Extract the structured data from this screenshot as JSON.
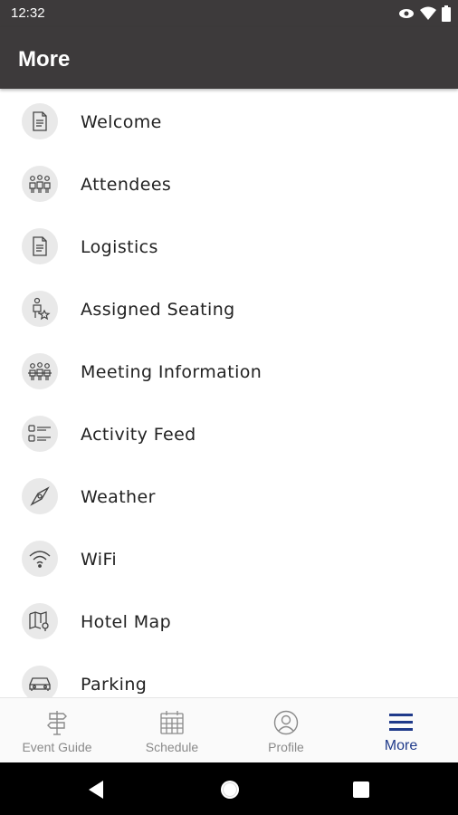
{
  "status_bar": {
    "time": "12:32",
    "icons": [
      "eye-icon",
      "wifi-icon",
      "battery-icon"
    ]
  },
  "app_bar": {
    "title": "More"
  },
  "menu": {
    "items": [
      {
        "label": "Welcome",
        "icon": "document-icon"
      },
      {
        "label": "Attendees",
        "icon": "people-group-icon"
      },
      {
        "label": "Logistics",
        "icon": "document-icon"
      },
      {
        "label": "Assigned Seating",
        "icon": "seating-icon"
      },
      {
        "label": "Meeting Information",
        "icon": "people-group-icon"
      },
      {
        "label": "Activity Feed",
        "icon": "list-icon"
      },
      {
        "label": "Weather",
        "icon": "compass-icon"
      },
      {
        "label": "WiFi",
        "icon": "wifi-icon"
      },
      {
        "label": "Hotel Map",
        "icon": "map-pin-icon"
      },
      {
        "label": "Parking",
        "icon": "car-icon"
      }
    ]
  },
  "bottom_nav": {
    "items": [
      {
        "label": "Event Guide",
        "icon": "signpost-icon",
        "active": false
      },
      {
        "label": "Schedule",
        "icon": "calendar-icon",
        "active": false
      },
      {
        "label": "Profile",
        "icon": "profile-icon",
        "active": false
      },
      {
        "label": "More",
        "icon": "hamburger-menu-icon",
        "active": true
      }
    ]
  },
  "colors": {
    "app_bar": "#3d3a3b",
    "active_tab": "#1f3a8a",
    "inactive_tab": "#8a8a8a",
    "icon_circle": "#e9e9e9"
  }
}
